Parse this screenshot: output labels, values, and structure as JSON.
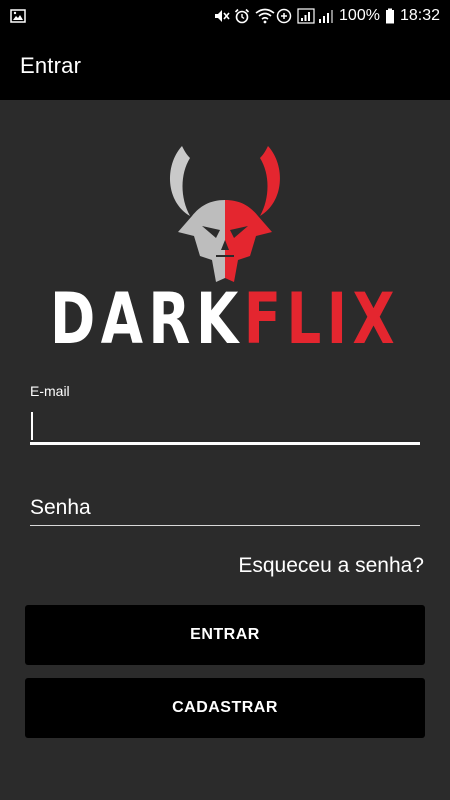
{
  "status_bar": {
    "battery_percent": "100%",
    "time": "18:32",
    "icons": [
      "image-icon",
      "mute-icon",
      "alarm-icon",
      "wifi-icon",
      "data-saver-icon",
      "signal-icon",
      "signal-icon-2",
      "battery-icon"
    ]
  },
  "app_bar": {
    "title": "Entrar"
  },
  "logo": {
    "word_dark": "DARK",
    "word_flix": "FLIX",
    "accent_color": "#e4262f"
  },
  "form": {
    "email": {
      "label": "E-mail",
      "value": ""
    },
    "password": {
      "placeholder": "Senha",
      "value": ""
    },
    "forgot_password": "Esqueceu a senha?"
  },
  "buttons": {
    "login": "ENTRAR",
    "register": "CADASTRAR"
  },
  "colors": {
    "background": "#2b2b2b",
    "bar": "#000000",
    "button": "#000000",
    "text": "#ffffff"
  }
}
